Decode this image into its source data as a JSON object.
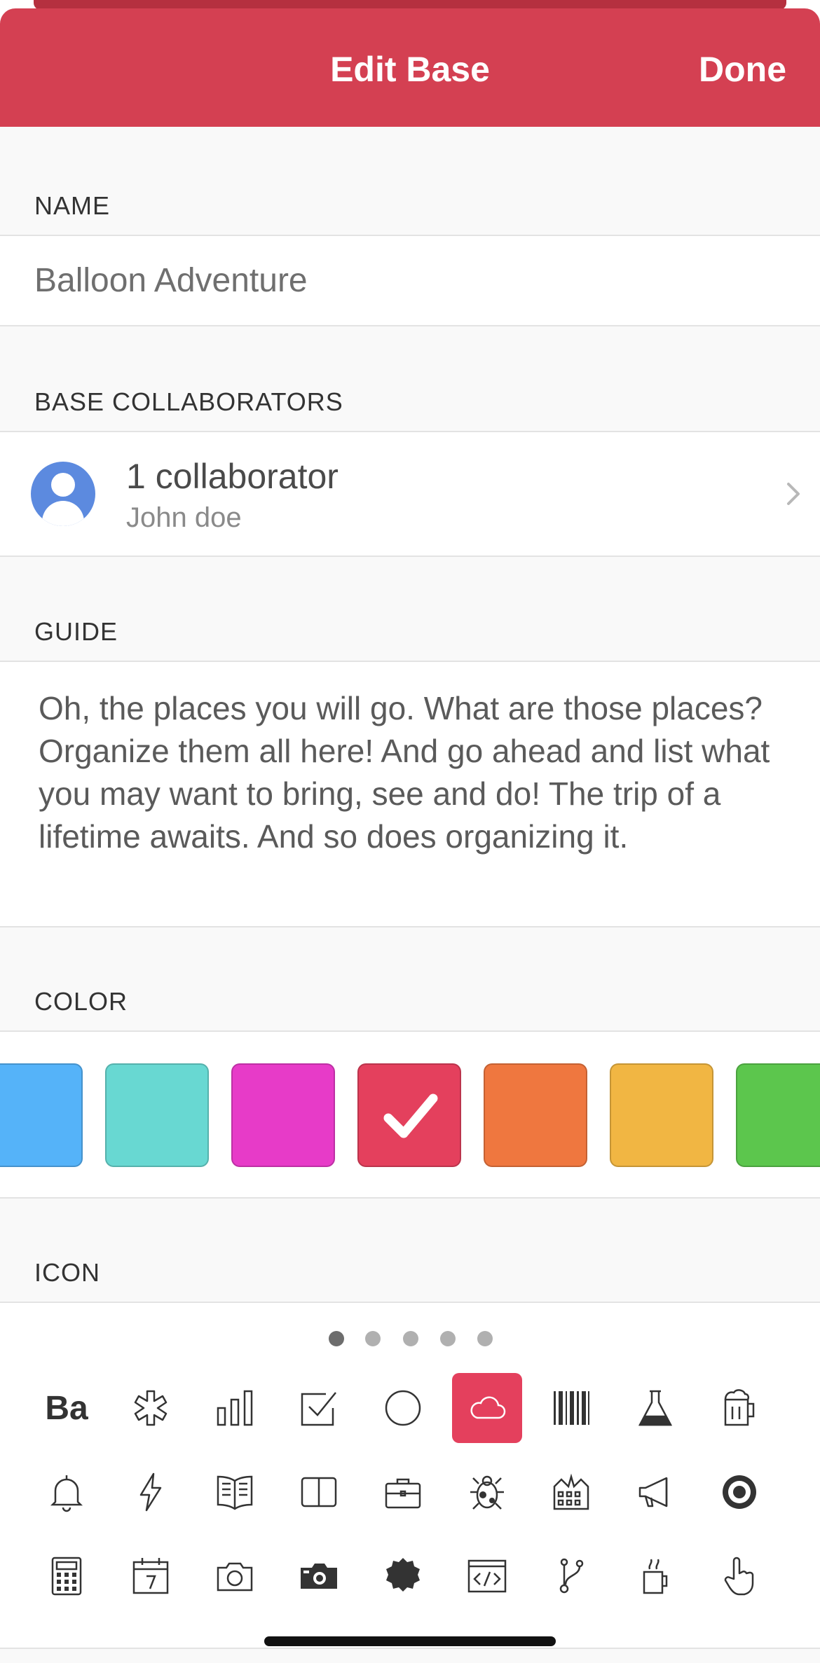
{
  "header": {
    "title": "Edit Base",
    "done_label": "Done"
  },
  "name_section": {
    "label": "NAME",
    "value": "Balloon Adventure"
  },
  "collaborators_section": {
    "label": "BASE COLLABORATORS",
    "count_text": "1 collaborator",
    "names": "John doe"
  },
  "guide_section": {
    "label": "GUIDE",
    "text": "Oh, the places you will go. What are those places? Organize them all here! And go ahead and list what you may want to bring, see and do! The trip of a lifetime awaits. And so does organizing it."
  },
  "color_section": {
    "label": "COLOR",
    "swatches": [
      {
        "name": "blue",
        "color": "#55b3f9"
      },
      {
        "name": "teal",
        "color": "#68d8d2"
      },
      {
        "name": "pink",
        "color": "#e73bc8"
      },
      {
        "name": "red",
        "color": "#e4405d",
        "selected": true
      },
      {
        "name": "orange",
        "color": "#ef773f"
      },
      {
        "name": "yellow",
        "color": "#f1b643"
      },
      {
        "name": "green",
        "color": "#5cc64d"
      }
    ]
  },
  "icon_section": {
    "label": "ICON",
    "page_count": 5,
    "current_page": 1,
    "ba_text": "Ba",
    "rows": [
      [
        "text-ba-icon",
        "asterisk-icon",
        "bar-chart-icon",
        "checkbox-icon",
        "circle-icon",
        "cloud-icon",
        "barcode-icon",
        "flask-icon",
        "beer-mug-icon"
      ],
      [
        "bell-icon",
        "lightning-icon",
        "open-book-icon",
        "closed-book-icon",
        "briefcase-icon",
        "bug-icon",
        "building-icon",
        "megaphone-icon",
        "target-icon"
      ],
      [
        "calculator-icon",
        "calendar-icon",
        "camera-icon",
        "film-camera-icon",
        "badge-icon",
        "code-window-icon",
        "git-branch-icon",
        "coffee-cup-icon",
        "hand-pointer-icon"
      ]
    ],
    "selected_icon": "cloud-icon",
    "selected_color": "#e4405d"
  },
  "colors": {
    "accent": "#d44052"
  }
}
